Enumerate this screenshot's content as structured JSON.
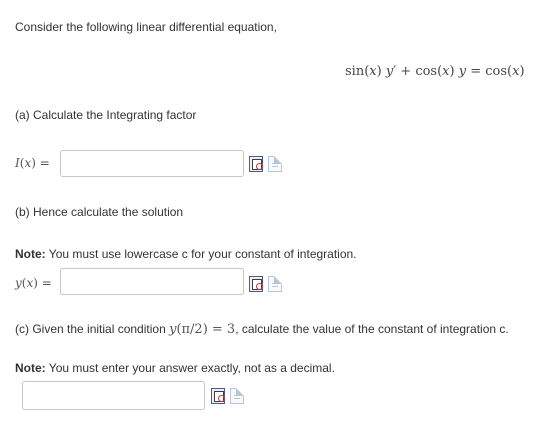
{
  "intro": "Consider the following linear differential equation,",
  "equation": {
    "lhs_a": "sin(",
    "var_x1": "x",
    "lhs_b": ")",
    "var_y1": "y",
    "prime": "′",
    "plus": " + cos(",
    "var_x2": "x",
    "lhs_c": ")",
    "var_y2": "y",
    "eq": " = cos(",
    "var_x3": "x",
    "rhs_end": ")"
  },
  "part_a": {
    "question": "(a) Calculate the Integrating factor",
    "label_fn": "I",
    "label_open": "(",
    "label_var": "x",
    "label_close": ") =",
    "value": "",
    "preview_icon": "preview-icon",
    "help_icon": "help-icon"
  },
  "part_b": {
    "question": "(b) Hence calculate the solution",
    "note_bold": "Note:",
    "note_text": " You must use lowercase c for your constant of integration.",
    "label_fn": "y",
    "label_open": "(",
    "label_var": "x",
    "label_close": ") =",
    "value": "",
    "preview_icon": "preview-icon",
    "help_icon": "help-icon"
  },
  "part_c": {
    "question_start": "(c) Given the initial condition ",
    "cond_fn": "y",
    "cond_mid": "(π/2) = 3",
    "question_end": ", calculate the value of the constant of integration c.",
    "note_bold": "Note:",
    "note_text": " You must enter your answer exactly, not as a decimal.",
    "value": "",
    "preview_icon": "preview-icon",
    "help_icon": "help-icon"
  }
}
